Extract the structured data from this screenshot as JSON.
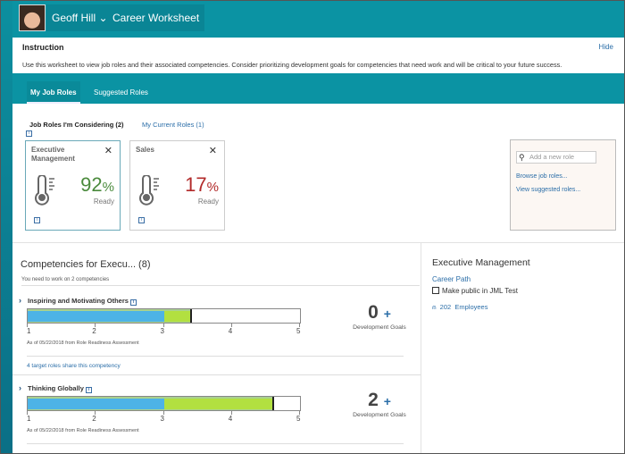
{
  "header": {
    "user_name": "Geoff Hill",
    "app_title": "Career Worksheet"
  },
  "instruction": {
    "title": "Instruction",
    "hide_label": "Hide",
    "text": "Use this worksheet to view job roles and their associated competencies. Consider prioritizing development goals for competencies that need work and will be critical to your future success."
  },
  "tabs": [
    {
      "label": "My Job Roles",
      "active": true
    },
    {
      "label": "Suggested Roles",
      "active": false
    }
  ],
  "subtabs": {
    "considering": "Job Roles I'm Considering (2)",
    "current": "My Current Roles (1)"
  },
  "cards": [
    {
      "title": "Executive Management",
      "pct": "92",
      "unit": "%",
      "status": "Ready",
      "color": "#4a8a3c",
      "selected": true
    },
    {
      "title": "Sales",
      "pct": "17",
      "unit": "%",
      "status": "Ready",
      "color": "#b22a2a",
      "selected": false
    }
  ],
  "add_role": {
    "placeholder": "Add a new role",
    "browse": "Browse job roles...",
    "suggested": "View suggested roles..."
  },
  "competencies": {
    "title": "Competencies for Execu... (8)",
    "need": "You need to work on 2 competencies",
    "scale": [
      "1",
      "2",
      "3",
      "4",
      "5"
    ],
    "items": [
      {
        "name": "Inspiring and Motivating Others",
        "current": 3,
        "target": 3.4,
        "as_of": "As of 05/22/2018 from Role Readiness Assessment",
        "goals": "0",
        "goals_label": "Development Goals",
        "share": "4 target roles share this competency"
      },
      {
        "name": "Thinking Globally",
        "current": 3,
        "target": 4.6,
        "as_of": "As of 05/22/2018 from Role Readiness Assessment",
        "goals": "2",
        "goals_label": "Development Goals"
      }
    ]
  },
  "role_panel": {
    "title": "Executive Management",
    "career_path": "Career Path",
    "make_public": "Make public in JML Test",
    "count": "202",
    "employees": "Employees"
  },
  "colors": {
    "teal": "#0b93a3",
    "current": "#4db3e6",
    "target": "#b2e040",
    "link": "#2b6ea8"
  }
}
